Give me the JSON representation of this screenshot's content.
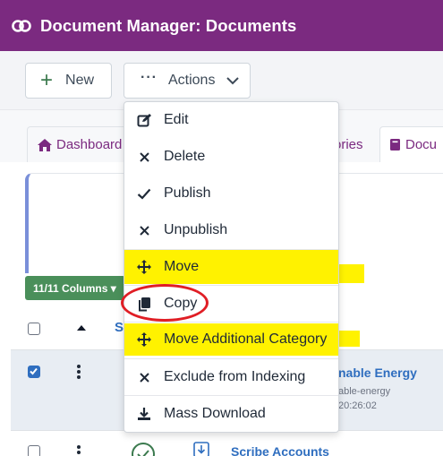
{
  "header": {
    "title": "Document Manager: Documents",
    "logo_icon": "joomla-logo-icon"
  },
  "toolbar": {
    "new_label": "New",
    "actions_label": "Actions"
  },
  "tabs": [
    {
      "label": "Dashboard",
      "icon": "home-icon"
    },
    {
      "label": "ories"
    },
    {
      "label": "Docu",
      "icon": "book-icon"
    }
  ],
  "columns_button": {
    "label": "11/11 Columns ▾"
  },
  "table": {
    "header_sort_label": "S",
    "rows": [
      {
        "title": "nable Energy",
        "alias": "able-energy",
        "date": "20:26:02",
        "checked": true
      },
      {
        "title": "Scribe Accounts",
        "checked": false
      }
    ]
  },
  "actions_menu": {
    "items": [
      {
        "label": "Edit",
        "icon": "edit-icon"
      },
      {
        "label": "Delete",
        "icon": "close-icon"
      },
      {
        "label": "Publish",
        "icon": "check-icon"
      },
      {
        "label": "Unpublish",
        "icon": "close-icon"
      },
      {
        "label": "Move",
        "icon": "move-arrows-icon"
      },
      {
        "label": "Copy",
        "icon": "copy-icon"
      },
      {
        "label": "Move Additional Category",
        "icon": "move-arrows-icon"
      },
      {
        "label": "Exclude from Indexing",
        "icon": "close-icon"
      },
      {
        "label": "Mass Download",
        "icon": "download-icon"
      }
    ]
  },
  "colors": {
    "brand": "#7b2a80",
    "highlight": "#fff200",
    "annotation_circle": "#e01e25",
    "link": "#2f6ebf",
    "columns_btn": "#4a8f5a"
  }
}
